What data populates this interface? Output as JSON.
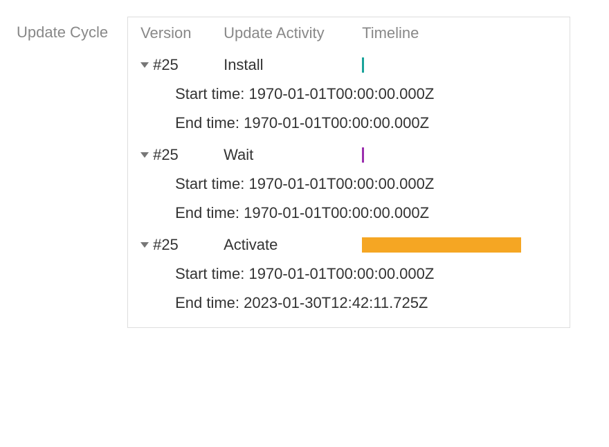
{
  "section_label": "Update Cycle",
  "headers": {
    "version": "Version",
    "activity": "Update Activity",
    "timeline": "Timeline"
  },
  "detail_labels": {
    "start": "Start time:",
    "end": "End time:"
  },
  "rows": [
    {
      "version": "#25",
      "activity": "Install",
      "bar_color": "#1aa39a",
      "bar_class": "bar-tiny",
      "start_time": "1970-01-01T00:00:00.000Z",
      "end_time": "1970-01-01T00:00:00.000Z"
    },
    {
      "version": "#25",
      "activity": "Wait",
      "bar_color": "#9b2fae",
      "bar_class": "bar-tiny",
      "start_time": "1970-01-01T00:00:00.000Z",
      "end_time": "1970-01-01T00:00:00.000Z"
    },
    {
      "version": "#25",
      "activity": "Activate",
      "bar_color": "#f5a623",
      "bar_class": "bar-full",
      "start_time": "1970-01-01T00:00:00.000Z",
      "end_time": "2023-01-30T12:42:11.725Z"
    }
  ]
}
